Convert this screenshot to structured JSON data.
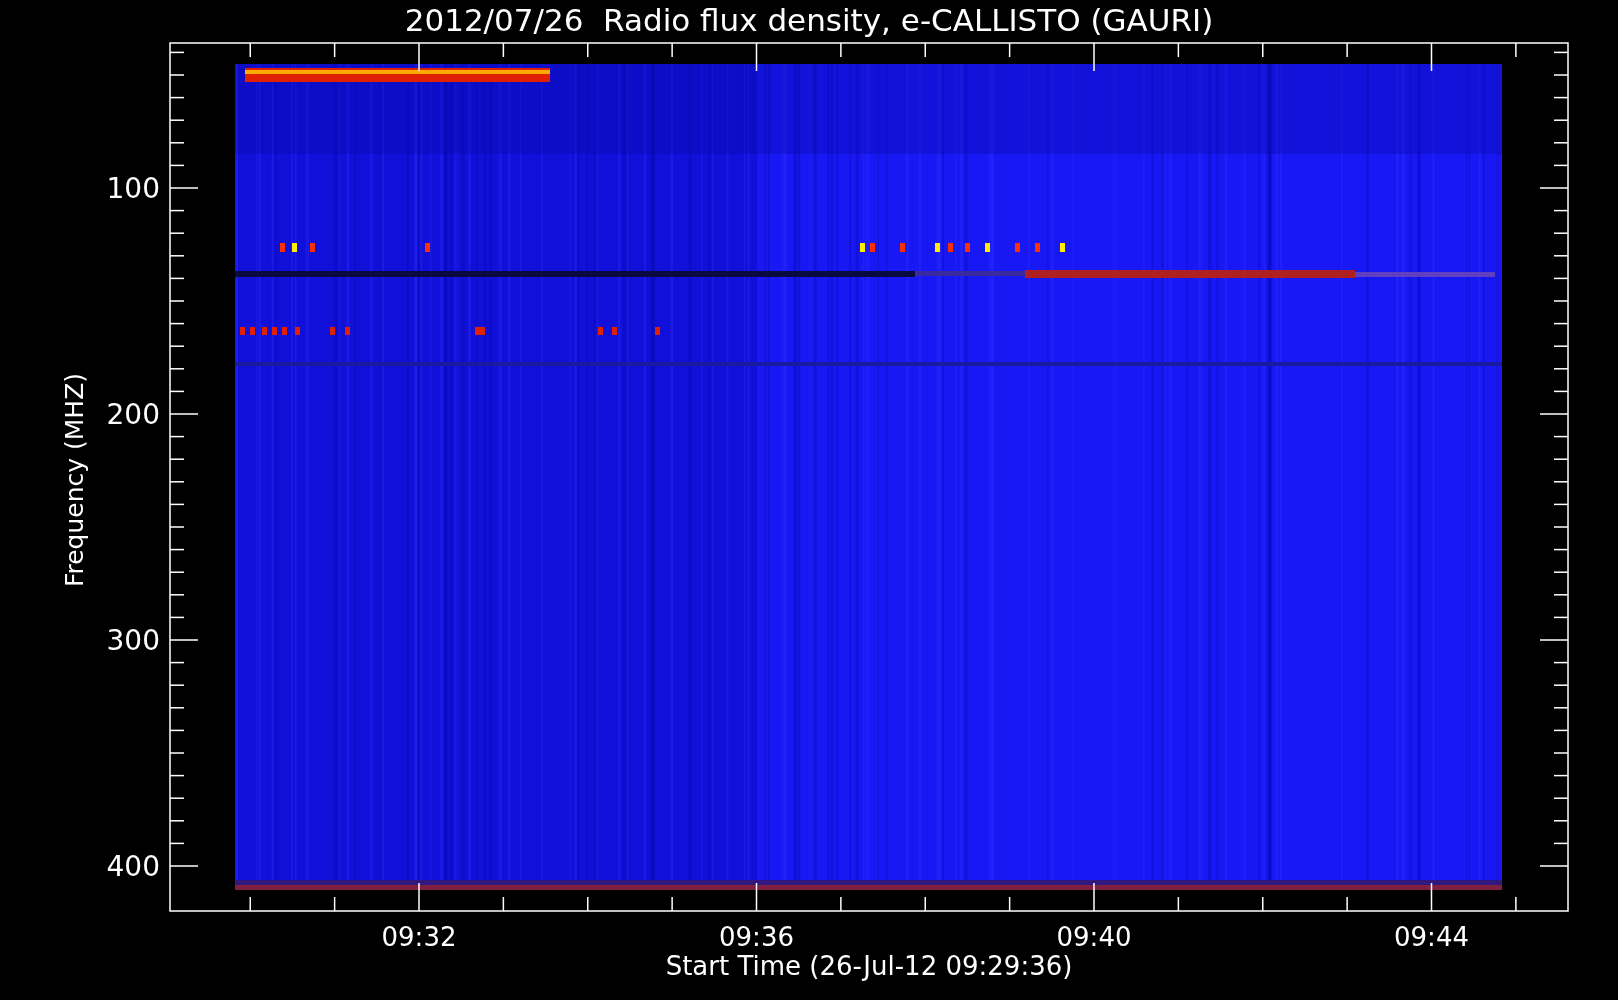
{
  "title": "2012/07/26  Radio flux density, e-CALLISTO (GAURI)",
  "y_axis": {
    "label": "Frequency (MHZ)",
    "ticks": [
      "100",
      "200",
      "300",
      "400"
    ]
  },
  "x_axis": {
    "label": "Start Time (26-Jul-12 09:29:36)",
    "ticks": [
      "09:32",
      "09:36",
      "09:40",
      "09:44"
    ]
  }
}
